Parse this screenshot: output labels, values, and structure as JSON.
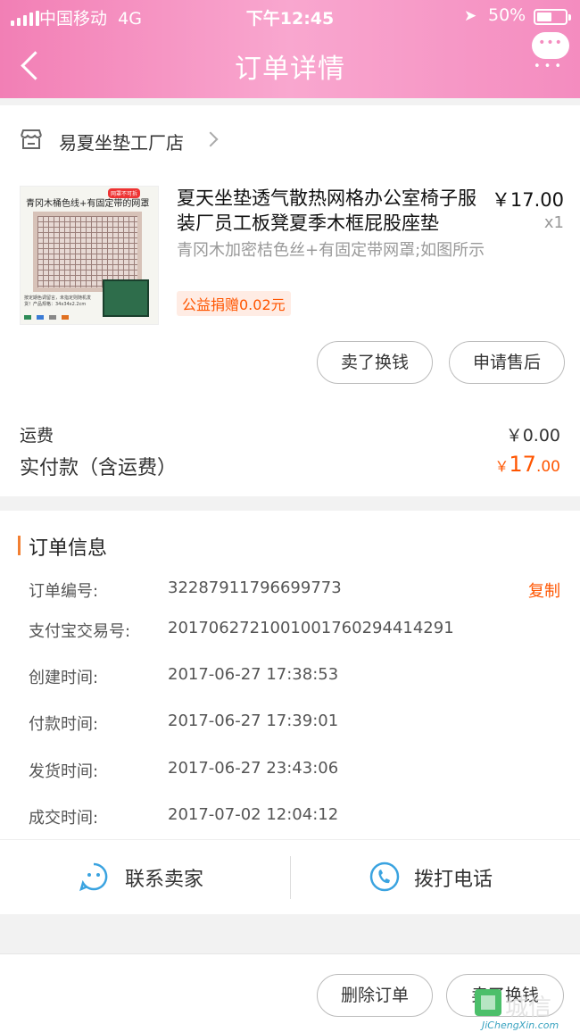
{
  "status_bar": {
    "carrier": "中国移动",
    "network": "4G",
    "time": "下午12:45",
    "battery": "50%"
  },
  "nav": {
    "title": "订单详情",
    "back_icon": "chevron-left-icon",
    "more_icon": "chat-bubble-more-icon"
  },
  "shop": {
    "name": "易夏坐垫工厂店",
    "icon": "store-icon"
  },
  "product": {
    "title": "夏天坐垫透气散热网格办公室椅子服装厂员工板凳夏季木框屁股座垫",
    "price": "￥17.00",
    "quantity": "x1",
    "sku": "青冈木加密桔色丝+有固定带网罩;如图所示",
    "badge": "公益捐赠0.02元",
    "image": {
      "caption": "青冈木桶色线+有固定带的网罩",
      "tag": "网罩不可拆",
      "small_text": "按定期色调留言，未指定则随机发货！产品规格：34x34x2.2cm",
      "swatch_colors": [
        "#2e8b57",
        "#3a7bd5",
        "#888888",
        "#e07020"
      ]
    }
  },
  "product_buttons": {
    "sell": "卖了换钱",
    "after_sale": "申请售后"
  },
  "fees": {
    "shipping_label": "运费",
    "shipping_value": "￥0.00",
    "total_label": "实付款（含运费）",
    "total_symbol": "￥",
    "total_int": "17",
    "total_dec": ".00"
  },
  "order_info": {
    "title": "订单信息",
    "copy": "复制",
    "rows": [
      {
        "label": "订单编号:",
        "value": "32287911796699773"
      },
      {
        "label": "支付宝交易号:",
        "value": "2017062721001001760294414291"
      },
      {
        "label": "创建时间:",
        "value": "2017-06-27 17:38:53"
      },
      {
        "label": "付款时间:",
        "value": "2017-06-27 17:39:01"
      },
      {
        "label": "发货时间:",
        "value": "2017-06-27 23:43:06"
      },
      {
        "label": "成交时间:",
        "value": "2017-07-02 12:04:12"
      }
    ]
  },
  "contact": {
    "seller": "联系卖家",
    "seller_icon": "chat-smile-icon",
    "phone": "拨打电话",
    "phone_icon": "phone-icon"
  },
  "bottom_bar": {
    "delete": "删除订单",
    "sell": "卖了换钱"
  },
  "watermark": {
    "cn": "城信",
    "en": "JiChengXin.com"
  },
  "colors": {
    "header_pink": "#f48cbf",
    "accent_orange": "#ff5500",
    "icon_blue": "#3aa3e0"
  }
}
